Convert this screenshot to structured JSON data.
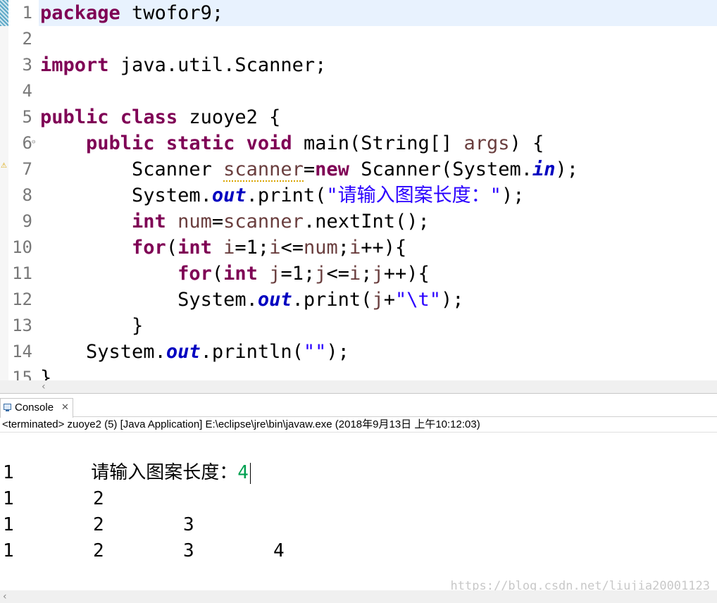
{
  "editor": {
    "line_numbers": [
      "1",
      "2",
      "3",
      "4",
      "5",
      "6",
      "7",
      "8",
      "9",
      "10",
      "11",
      "12",
      "13",
      "14",
      "15"
    ],
    "lines": [
      [
        {
          "t": "kw",
          "v": "package"
        },
        {
          "t": "plain",
          "v": " twofor9;"
        }
      ],
      [],
      [
        {
          "t": "kw",
          "v": "import"
        },
        {
          "t": "plain",
          "v": " java.util.Scanner;"
        }
      ],
      [],
      [
        {
          "t": "kw",
          "v": "public"
        },
        {
          "t": "plain",
          "v": " "
        },
        {
          "t": "kw",
          "v": "class"
        },
        {
          "t": "plain",
          "v": " zuoye2 {"
        }
      ],
      [
        {
          "t": "plain",
          "v": "    "
        },
        {
          "t": "kw",
          "v": "public"
        },
        {
          "t": "plain",
          "v": " "
        },
        {
          "t": "kw",
          "v": "static"
        },
        {
          "t": "plain",
          "v": " "
        },
        {
          "t": "kw",
          "v": "void"
        },
        {
          "t": "plain",
          "v": " main(String[] "
        },
        {
          "t": "var",
          "v": "args"
        },
        {
          "t": "plain",
          "v": ") {"
        }
      ],
      [
        {
          "t": "plain",
          "v": "        Scanner "
        },
        {
          "t": "warn",
          "v": "scanner"
        },
        {
          "t": "plain",
          "v": "="
        },
        {
          "t": "kw",
          "v": "new"
        },
        {
          "t": "plain",
          "v": " Scanner(System."
        },
        {
          "t": "field",
          "v": "in"
        },
        {
          "t": "plain",
          "v": ");"
        }
      ],
      [
        {
          "t": "plain",
          "v": "        System."
        },
        {
          "t": "field",
          "v": "out"
        },
        {
          "t": "plain",
          "v": ".print("
        },
        {
          "t": "str",
          "v": "\"请输入图案长度：\""
        },
        {
          "t": "plain",
          "v": ");"
        }
      ],
      [
        {
          "t": "plain",
          "v": "        "
        },
        {
          "t": "kw",
          "v": "int"
        },
        {
          "t": "plain",
          "v": " "
        },
        {
          "t": "var",
          "v": "num"
        },
        {
          "t": "plain",
          "v": "="
        },
        {
          "t": "var",
          "v": "scanner"
        },
        {
          "t": "plain",
          "v": ".nextInt();"
        }
      ],
      [
        {
          "t": "plain",
          "v": "        "
        },
        {
          "t": "kw",
          "v": "for"
        },
        {
          "t": "plain",
          "v": "("
        },
        {
          "t": "kw",
          "v": "int"
        },
        {
          "t": "plain",
          "v": " "
        },
        {
          "t": "var",
          "v": "i"
        },
        {
          "t": "plain",
          "v": "=1;"
        },
        {
          "t": "var",
          "v": "i"
        },
        {
          "t": "plain",
          "v": "<="
        },
        {
          "t": "var",
          "v": "num"
        },
        {
          "t": "plain",
          "v": ";"
        },
        {
          "t": "var",
          "v": "i"
        },
        {
          "t": "plain",
          "v": "++){"
        }
      ],
      [
        {
          "t": "plain",
          "v": "            "
        },
        {
          "t": "kw",
          "v": "for"
        },
        {
          "t": "plain",
          "v": "("
        },
        {
          "t": "kw",
          "v": "int"
        },
        {
          "t": "plain",
          "v": " "
        },
        {
          "t": "var",
          "v": "j"
        },
        {
          "t": "plain",
          "v": "=1;"
        },
        {
          "t": "var",
          "v": "j"
        },
        {
          "t": "plain",
          "v": "<="
        },
        {
          "t": "var",
          "v": "i"
        },
        {
          "t": "plain",
          "v": ";"
        },
        {
          "t": "var",
          "v": "j"
        },
        {
          "t": "plain",
          "v": "++){"
        }
      ],
      [
        {
          "t": "plain",
          "v": "            System."
        },
        {
          "t": "field",
          "v": "out"
        },
        {
          "t": "plain",
          "v": ".print("
        },
        {
          "t": "var",
          "v": "j"
        },
        {
          "t": "plain",
          "v": "+"
        },
        {
          "t": "str",
          "v": "\"\\t\""
        },
        {
          "t": "plain",
          "v": ");"
        }
      ],
      [
        {
          "t": "plain",
          "v": "        }"
        }
      ],
      [
        {
          "t": "plain",
          "v": "    System."
        },
        {
          "t": "field",
          "v": "out"
        },
        {
          "t": "plain",
          "v": ".println("
        },
        {
          "t": "str",
          "v": "\"\""
        },
        {
          "t": "plain",
          "v": ");"
        }
      ],
      [
        {
          "t": "plain",
          "v": "}"
        }
      ]
    ]
  },
  "console": {
    "tab_label": "Console",
    "close_glyph": "✕",
    "status": "<terminated> zuoye2 (5) [Java Application] E:\\eclipse\\jre\\bin\\javaw.exe (2018年9月13日 上午10:12:03)",
    "prompt": "请输入图案长度：",
    "input_value": "4",
    "output_rows": [
      [
        "1"
      ],
      [
        "1",
        "2"
      ],
      [
        "1",
        "2",
        "3"
      ],
      [
        "1",
        "2",
        "3",
        "4"
      ]
    ],
    "watermark": "https://blog.csdn.net/liujia20001123"
  },
  "scroll_left_glyph": "‹"
}
